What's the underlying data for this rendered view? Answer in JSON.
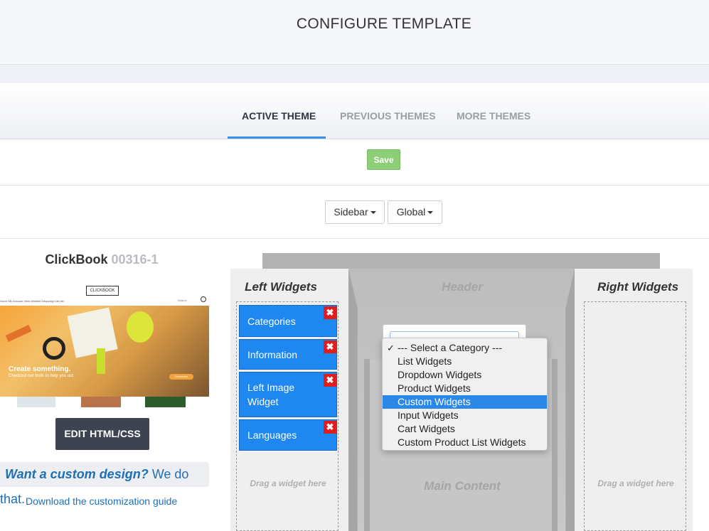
{
  "page": {
    "title": "CONFIGURE TEMPLATE"
  },
  "tabs": [
    {
      "label": "ACTIVE THEME",
      "active": true
    },
    {
      "label": "PREVIOUS THEMES",
      "active": false
    },
    {
      "label": "MORE THEMES",
      "active": false
    }
  ],
  "actions": {
    "save_label": "Save"
  },
  "filters": {
    "sidebar_label": "Sidebar",
    "global_label": "Global"
  },
  "theme": {
    "name": "ClickBook",
    "code": "00316-1",
    "preview": {
      "logo": "CLICKBOOK",
      "nav": "Home   My Account   View Wishlist   Shopping Cart list",
      "search": "Search",
      "hero_title": "Create something.",
      "hero_sub": "Checkout our tools to help you out",
      "hero_button": "Download"
    },
    "edit_label": "EDIT HTML/CSS",
    "custom_em": "Want a custom design?",
    "custom_rest": "We do that.",
    "guide_link": "Download the customization guide"
  },
  "layout": {
    "left_title": "Left Widgets",
    "right_title": "Right Widgets",
    "header_label": "Header",
    "main_label": "Main Content",
    "drag_hint": "Drag a widget here",
    "left_widgets": [
      "Categories",
      "Information",
      "Left Image Widget",
      "Languages"
    ],
    "remove_glyph": "✖"
  },
  "category_menu": {
    "check": "✓",
    "options": [
      "--- Select a Category ---",
      "List Widgets",
      "Dropdown Widgets",
      "Product Widgets",
      "Custom Widgets",
      "Input Widgets",
      "Cart Widgets",
      "Custom Product List Widgets"
    ],
    "checked_index": 0,
    "highlighted_index": 4
  },
  "colors": {
    "accent": "#3a8ee6",
    "save": "#8ccf76",
    "widget": "#1f87f0",
    "remove": "#e01d1d",
    "highlight": "#2b88e8"
  }
}
